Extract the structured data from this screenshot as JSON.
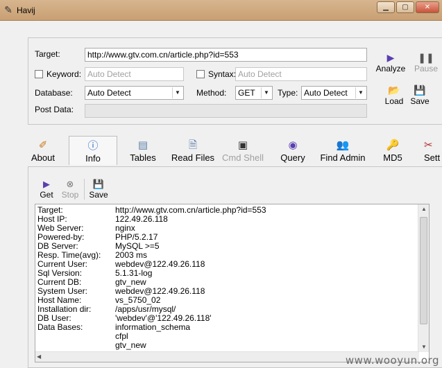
{
  "window": {
    "title": "Havij"
  },
  "target_panel": {
    "target_label": "Target:",
    "target_value": "http://www.gtv.com.cn/article.php?id=553",
    "keyword_label": "Keyword:",
    "keyword_value": "Auto Detect",
    "syntax_label": "Syntax:",
    "syntax_value": "Auto Detect",
    "database_label": "Database:",
    "database_value": "Auto Detect",
    "method_label": "Method:",
    "method_value": "GET",
    "type_label": "Type:",
    "type_value": "Auto Detect",
    "postdata_label": "Post Data:",
    "postdata_value": "",
    "buttons": {
      "analyze": "Analyze",
      "pause": "Pause",
      "load": "Load",
      "save": "Save"
    }
  },
  "tabs": {
    "about": "About",
    "info": "Info",
    "tables": "Tables",
    "read_files": "Read Files",
    "cmd_shell": "Cmd Shell",
    "query": "Query",
    "find_admin": "Find Admin",
    "md5": "MD5",
    "settings": "Sett"
  },
  "info_toolbar": {
    "get": "Get",
    "stop": "Stop",
    "save": "Save"
  },
  "info": {
    "rows": [
      {
        "key": "Target:",
        "value": "http://www.gtv.com.cn/article.php?id=553"
      },
      {
        "key": "Host IP:",
        "value": "122.49.26.118"
      },
      {
        "key": "Web Server:",
        "value": "nginx"
      },
      {
        "key": "Powered-by:",
        "value": "PHP/5.2.17"
      },
      {
        "key": "DB Server:",
        "value": "MySQL >=5"
      },
      {
        "key": "Resp. Time(avg):",
        "value": "2003 ms"
      },
      {
        "key": "Current User:",
        "value": "webdev@122.49.26.118"
      },
      {
        "key": "Sql Version:",
        "value": "5.1.31-log"
      },
      {
        "key": "Current DB:",
        "value": "gtv_new"
      },
      {
        "key": "System User:",
        "value": "webdev@122.49.26.118"
      },
      {
        "key": "Host Name:",
        "value": "vs_5750_02"
      },
      {
        "key": "Installation dir:",
        "value": "/apps/usr/mysql/"
      },
      {
        "key": "DB User:",
        "value": "'webdev'@'122.49.26.118'"
      },
      {
        "key": "Data Bases:",
        "value": "information_schema"
      },
      {
        "key": "",
        "value": "cfpl"
      },
      {
        "key": "",
        "value": "gtv_new"
      }
    ]
  },
  "watermark": "www.wooyun.org"
}
